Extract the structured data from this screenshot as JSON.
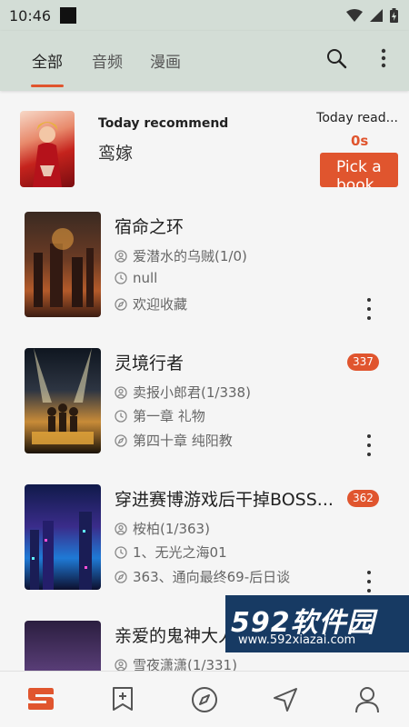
{
  "status_bar": {
    "time": "10:46"
  },
  "tabs": [
    {
      "label": "全部",
      "active": true
    },
    {
      "label": "音频",
      "active": false
    },
    {
      "label": "漫画",
      "active": false
    }
  ],
  "recommend": {
    "heading": "Today recommend",
    "book_title": "鸾嫁",
    "reading_label": "Today read...",
    "reading_time": "0s",
    "pick_button": "Pick a book"
  },
  "books": [
    {
      "title": "宿命之环",
      "author": "爱潜水的乌贼(1/0)",
      "last_read": "null",
      "latest": "欢迎收藏",
      "badge": ""
    },
    {
      "title": "灵境行者",
      "author": "卖报小郎君(1/338)",
      "last_read": "第一章 礼物",
      "latest": "第四十章 纯阳教",
      "badge": "337"
    },
    {
      "title": "穿进赛博游戏后干掉BOSS...",
      "author": "桉柏(1/363)",
      "last_read": "1、无光之海01",
      "latest": "363、通向最终69-后日谈",
      "badge": "362"
    },
    {
      "title": "亲爱的鬼神大人",
      "author": "雪夜潇潇(1/331)",
      "last_read": "",
      "latest": "",
      "badge": ""
    }
  ],
  "watermark": {
    "brand": "592软件园",
    "url": "www.592xiazai.com"
  },
  "bottom_nav": [
    "home-icon",
    "bookmark-add-icon",
    "compass-icon",
    "navigation-icon",
    "profile-icon"
  ],
  "colors": {
    "accent": "#e0552e",
    "header_bg": "#d3ddd6",
    "page_bg": "#f5f5f5"
  }
}
